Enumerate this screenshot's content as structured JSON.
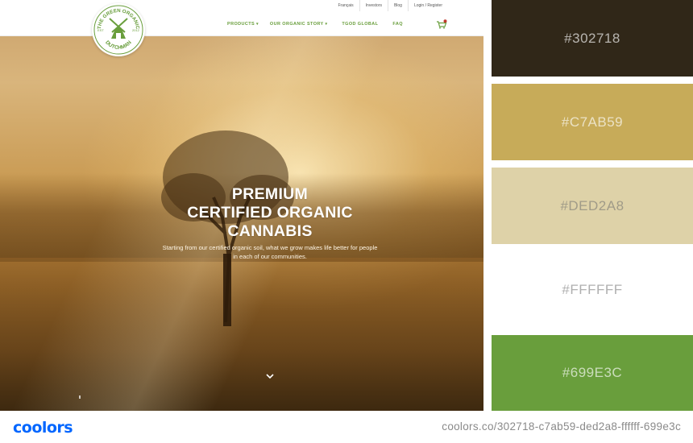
{
  "website": {
    "utility_nav": [
      "Français",
      "Investors",
      "Blog",
      "Login / Register"
    ],
    "main_nav": [
      {
        "label": "PRODUCTS",
        "caret": "▾"
      },
      {
        "label": "OUR ORGANIC STORY",
        "caret": "▾"
      },
      {
        "label": "TGOD GLOBAL",
        "caret": ""
      },
      {
        "label": "FAQ",
        "caret": ""
      }
    ],
    "logo": {
      "top_text": "THE GREEN ORGANIC",
      "bottom_text": "DUTCHMAN",
      "left_text": "EST",
      "right_text": "2012"
    },
    "hero": {
      "title_lines": [
        "PREMIUM",
        "CERTIFIED ORGANIC",
        "CANNABIS"
      ],
      "subtitle": "Starting from our certified organic soil, what we grow makes life better for people in each of our communities."
    },
    "icons": {
      "cart": "cart-icon",
      "scroll": "chevron-down-icon"
    }
  },
  "palette": {
    "swatches": [
      {
        "hex": "#302718",
        "label": "#302718"
      },
      {
        "hex": "#C7AB59",
        "label": "#C7AB59"
      },
      {
        "hex": "#DED2A8",
        "label": "#DED2A8"
      },
      {
        "hex": "#FFFFFF",
        "label": "#FFFFFF"
      },
      {
        "hex": "#699E3C",
        "label": "#699E3C"
      }
    ]
  },
  "footer": {
    "brand": "coolors",
    "url": "coolors.co/302718-c7ab59-ded2a8-ffffff-699e3c"
  },
  "colors": {
    "accent_green": "#699e3c",
    "brand_blue": "#0066ff"
  }
}
